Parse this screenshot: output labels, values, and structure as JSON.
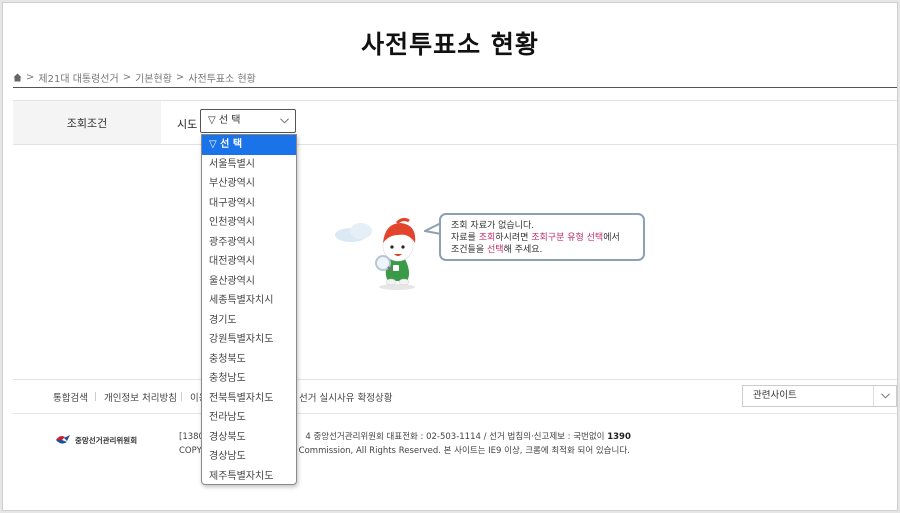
{
  "page": {
    "title": "사전투표소 현황"
  },
  "breadcrumb": {
    "items": [
      "제21대 대통령선거",
      "기본현황",
      "사전투표소 현황"
    ],
    "separator": ">"
  },
  "search": {
    "condition_label": "조회조건",
    "sido_label": "시도",
    "select_value": "▽ 선 택"
  },
  "dropdown": {
    "options": [
      "▽ 선 택",
      "서울특별시",
      "부산광역시",
      "대구광역시",
      "인천광역시",
      "광주광역시",
      "대전광역시",
      "울산광역시",
      "세종특별자치시",
      "경기도",
      "강원특별자치도",
      "충청북도",
      "충청남도",
      "전북특별자치도",
      "전라남도",
      "경상북도",
      "경상남도",
      "제주특별자치도"
    ],
    "selected_index": 0
  },
  "notice": {
    "line1": "조회 자료가 없습니다.",
    "line2_pre": "자료를 ",
    "line2_hl1": "조회",
    "line2_mid": "하시려면 ",
    "line2_hl2": "조회구분 유형 선택",
    "line2_post": "에서",
    "line3_pre": "조건들을 ",
    "line3_hl": "선택",
    "line3_post": "해 주세요."
  },
  "footer": {
    "links": [
      "통합검색",
      "개인정보 처리방침",
      "이용",
      "선거 실시사유 확정상황"
    ],
    "related_site_label": "관련사이트",
    "logo_text": "중앙선거관리위원회",
    "info_line1_a": "[13809",
    "info_line1_b": "4 중앙선거관리위원회 대표전화 : 02-503-1114 / 선거 법침의·신고제보 : 국번없이",
    "info_line1_num": "1390",
    "info_line2_a": "COPYR",
    "info_line2_b": "Commission, All Rights Reserved. 본 사이트는 IE9 이상, 크롬에 최적화 되어 있습니다."
  },
  "colors": {
    "accent": "#1a73e8",
    "highlight": "#c0306a",
    "bubble_border": "#8da0b5"
  }
}
